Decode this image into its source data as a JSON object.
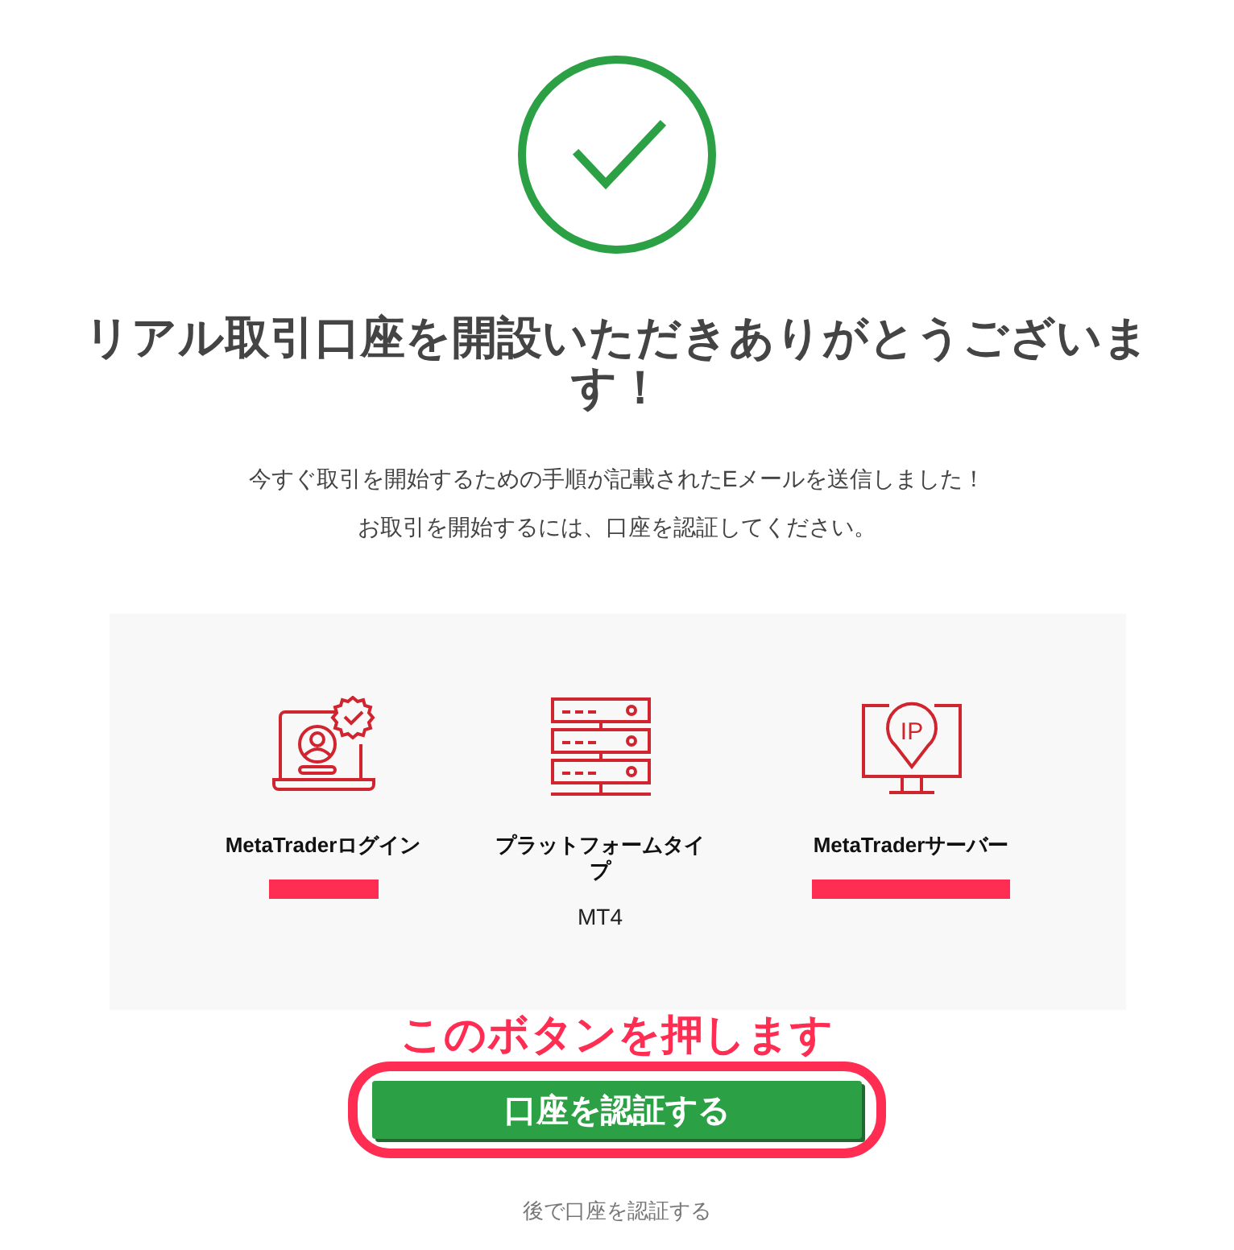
{
  "heading": "リアル取引口座を開設いただきありがとうございます！",
  "messages": [
    "今すぐ取引を開始するための手順が記載されたEメールを送信しました！",
    "お取引を開始するには、口座を認証してください。"
  ],
  "account_details": [
    {
      "label": "MetaTraderログイン",
      "redacted": true
    },
    {
      "label": "プラットフォームタイプ",
      "value": "MT4",
      "redacted": false
    },
    {
      "label": "MetaTraderサーバー",
      "redacted": true,
      "icon_text": "IP"
    }
  ],
  "annotation": {
    "text": "このボタンを押します"
  },
  "verify_button": {
    "label": "口座を認証する",
    "highlighted": true
  },
  "later_link": "後で口座を認証する"
}
